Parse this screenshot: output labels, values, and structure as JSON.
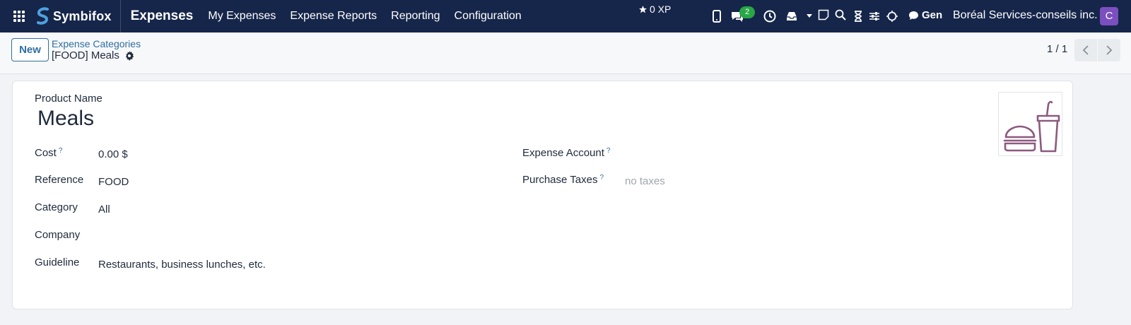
{
  "navbar": {
    "brand_name": "Symbifox",
    "app_title": "Expenses",
    "menu": [
      "My Expenses",
      "Expense Reports",
      "Reporting",
      "Configuration"
    ],
    "xp_label": "0 XP",
    "messages_count": "2",
    "gen_label": "Gen",
    "company": "Boréal Services-conseils inc.",
    "avatar_letter": "C",
    "icons": [
      "apps-grid-icon",
      "mobile-icon",
      "chat-icon",
      "clock-icon",
      "inbox-icon",
      "caret-down-icon",
      "note-icon",
      "search-icon",
      "hourglass-icon",
      "sliders-icon",
      "sun-icon",
      "chat-bubble-icon"
    ]
  },
  "control_panel": {
    "new_label": "New",
    "breadcrumb": "Expense Categories",
    "record_title": "[FOOD] Meals",
    "pager_value": "1 / 1"
  },
  "form": {
    "product_name_label": "Product Name",
    "product_name": "Meals",
    "left_fields": [
      {
        "label": "Cost",
        "help": "?",
        "value": "0.00 $"
      },
      {
        "label": "Reference",
        "value": "FOOD"
      },
      {
        "label": "Category",
        "value": "All"
      },
      {
        "label": "Company",
        "value": ""
      },
      {
        "label": "Guideline",
        "value": "Restaurants, business lunches, etc."
      }
    ],
    "right_fields": [
      {
        "label": "Expense Account",
        "help": "?",
        "value": ""
      },
      {
        "label": "Purchase Taxes",
        "help": "?",
        "placeholder": "no taxes"
      }
    ],
    "image": "burger-and-drink-icon"
  },
  "colors": {
    "navbar_bg": "#16264a",
    "accent": "#2f6f9f",
    "avatar": "#7b4fbf",
    "badge": "#28a745",
    "image_stroke": "#8c5a7f"
  }
}
